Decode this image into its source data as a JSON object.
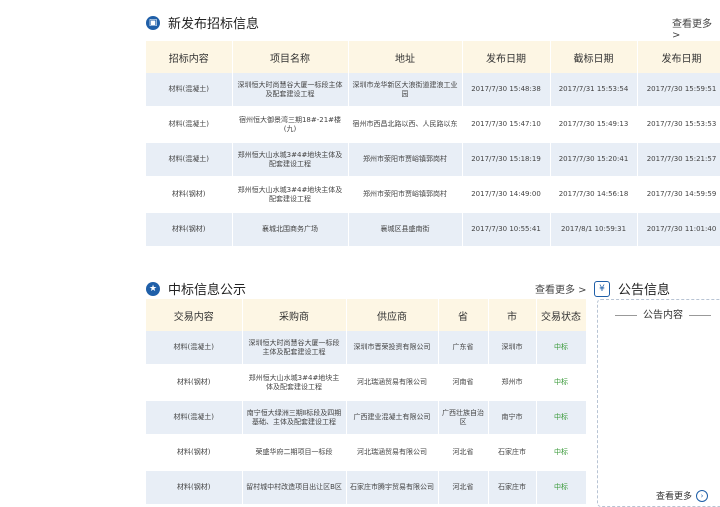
{
  "bidding": {
    "title": "新发布招标信息",
    "more": "查看更多 >",
    "columns": [
      "招标内容",
      "项目名称",
      "地址",
      "发布日期",
      "截标日期",
      "发布日期"
    ],
    "rows": [
      [
        "材料(混凝土)",
        "深圳恒大时尚慧谷大厦一标段主体及配套建设工程",
        "深圳市龙华新区大浪街道建浪工业园",
        "2017/7/30 15:48:38",
        "2017/7/31 15:53:54",
        "2017/7/30 15:59:51"
      ],
      [
        "材料(混凝土)",
        "宿州恒大御景湾三期18#-21#楼(九)",
        "宿州市西昌北路以西、人民路以东",
        "2017/7/30 15:47:10",
        "2017/7/30 15:49:13",
        "2017/7/30 15:53:53"
      ],
      [
        "材料(混凝土)",
        "郑州恒大山水城3#4#地块主体及配套建设工程",
        "郑州市荥阳市贾峪镇郭岗村",
        "2017/7/30 15:18:19",
        "2017/7/30 15:20:41",
        "2017/7/30 15:21:57"
      ],
      [
        "材料(钢材)",
        "郑州恒大山水城3#4#地块主体及配套建设工程",
        "郑州市荥阳市贾峪镇郭岗村",
        "2017/7/30 14:49:00",
        "2017/7/30 14:56:18",
        "2017/7/30 14:59:59"
      ],
      [
        "材料(钢材)",
        "襄城北围商务广场",
        "襄城区县盛南街",
        "2017/7/30 10:55:41",
        "2017/8/1 10:59:31",
        "2017/7/30 11:01:40"
      ]
    ]
  },
  "winning": {
    "title": "中标信息公示",
    "more": "查看更多 >",
    "columns": [
      "交易内容",
      "采购商",
      "供应商",
      "省",
      "市",
      "交易状态"
    ],
    "rows": [
      [
        "材料(混凝土)",
        "深圳恒大时尚慧谷大厦一标段主体及配套建设工程",
        "深圳市晋荣投资有限公司",
        "广东省",
        "深圳市",
        "中标"
      ],
      [
        "材料(钢材)",
        "郑州恒大山水城3#4#地块主体及配套建设工程",
        "河北瑞涵贸易有限公司",
        "河南省",
        "郑州市",
        "中标"
      ],
      [
        "材料(混凝土)",
        "南宁恒大绿洲三期Ⅱ标段及四期基础、主体及配套建设工程",
        "广西建业混凝土有限公司",
        "广西壮族自治区",
        "南宁市",
        "中标"
      ],
      [
        "材料(钢材)",
        "荣盛华府二期项目一标段",
        "河北瑞涵贸易有限公司",
        "河北省",
        "石家庄市",
        "中标"
      ],
      [
        "材料(钢材)",
        "留村城中村改造项目出让区B区",
        "石家庄市腾宇贸易有限公司",
        "河北省",
        "石家庄市",
        "中标"
      ]
    ]
  },
  "notice": {
    "title": "公告信息",
    "subtitle": "公告内容",
    "more": "查看更多"
  },
  "colors": {
    "accent": "#1f5fa8",
    "header_bg": "#fdf6e4",
    "row_bg": "#e8eef6",
    "status": "#3a9a3a"
  }
}
